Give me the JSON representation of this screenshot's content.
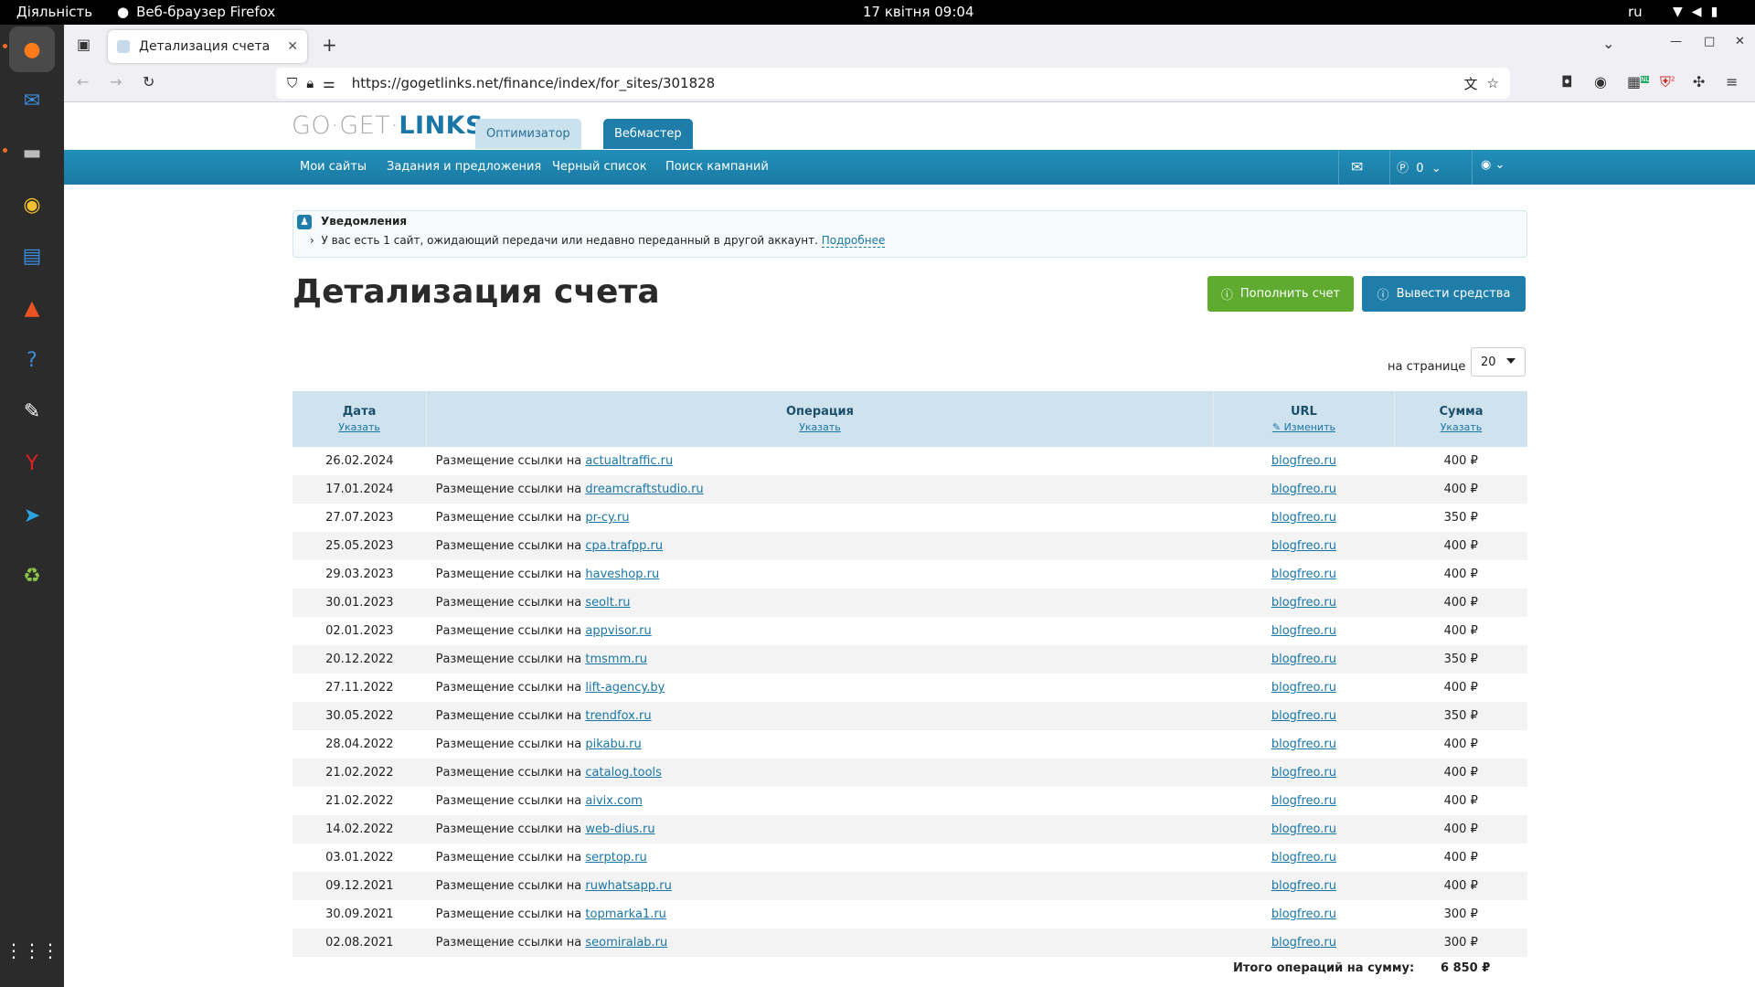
{
  "system": {
    "activities": "Діяльність",
    "app_name": "Веб-браузер Firefox",
    "datetime": "17 квітня  09:04",
    "lang": "ru"
  },
  "browser": {
    "tab_title": "Детализация счета",
    "url": "https://gogetlinks.net/finance/index/for_sites/301828",
    "ext_badge_nl": "NL",
    "ext_badge_count": "2"
  },
  "site": {
    "logo_go": "GO·GET·",
    "logo_links": "LINKS",
    "tab_optimizer": "Оптимизатор",
    "tab_webmaster": "Вебмастер",
    "nav": [
      "Мои сайты",
      "Задания и предложения",
      "Черный список",
      "Поиск кампаний"
    ],
    "balance": "0"
  },
  "notification": {
    "title": "Уведомления",
    "message": "У вас есть 1 сайт, ожидающий передачи или недавно переданный в другой аккаунт.",
    "link": "Подробнее"
  },
  "page": {
    "title": "Детализация счета",
    "topup_button": "Пополнить счет",
    "withdraw_button": "Вывести средства",
    "per_page_label": "на странице",
    "per_page_value": "20"
  },
  "table": {
    "headers": {
      "date": "Дата",
      "date_sub": "Указать",
      "operation": "Операция",
      "operation_sub": "Указать",
      "url": "URL",
      "url_sub": "Изменить",
      "sum": "Сумма",
      "sum_sub": "Указать"
    },
    "op_prefix": "Размещение ссылки на",
    "rows": [
      {
        "date": "26.02.2024",
        "site": "actualtraffic.ru",
        "url": "blogfreo.ru",
        "sum": "400 ₽"
      },
      {
        "date": "17.01.2024",
        "site": "dreamcraftstudio.ru",
        "url": "blogfreo.ru",
        "sum": "400 ₽"
      },
      {
        "date": "27.07.2023",
        "site": "pr-cy.ru",
        "url": "blogfreo.ru",
        "sum": "350 ₽"
      },
      {
        "date": "25.05.2023",
        "site": "cpa.trafpp.ru",
        "url": "blogfreo.ru",
        "sum": "400 ₽"
      },
      {
        "date": "29.03.2023",
        "site": "haveshop.ru",
        "url": "blogfreo.ru",
        "sum": "400 ₽"
      },
      {
        "date": "30.01.2023",
        "site": "seolt.ru",
        "url": "blogfreo.ru",
        "sum": "400 ₽"
      },
      {
        "date": "02.01.2023",
        "site": "appvisor.ru",
        "url": "blogfreo.ru",
        "sum": "400 ₽"
      },
      {
        "date": "20.12.2022",
        "site": "tmsmm.ru",
        "url": "blogfreo.ru",
        "sum": "350 ₽"
      },
      {
        "date": "27.11.2022",
        "site": "lift-agency.by",
        "url": "blogfreo.ru",
        "sum": "400 ₽"
      },
      {
        "date": "30.05.2022",
        "site": "trendfox.ru",
        "url": "blogfreo.ru",
        "sum": "350 ₽"
      },
      {
        "date": "28.04.2022",
        "site": "pikabu.ru",
        "url": "blogfreo.ru",
        "sum": "400 ₽"
      },
      {
        "date": "21.02.2022",
        "site": "catalog.tools",
        "url": "blogfreo.ru",
        "sum": "400 ₽"
      },
      {
        "date": "21.02.2022",
        "site": "aivix.com",
        "url": "blogfreo.ru",
        "sum": "400 ₽"
      },
      {
        "date": "14.02.2022",
        "site": "web-dius.ru",
        "url": "blogfreo.ru",
        "sum": "400 ₽"
      },
      {
        "date": "03.01.2022",
        "site": "serptop.ru",
        "url": "blogfreo.ru",
        "sum": "400 ₽"
      },
      {
        "date": "09.12.2021",
        "site": "ruwhatsapp.ru",
        "url": "blogfreo.ru",
        "sum": "400 ₽"
      },
      {
        "date": "30.09.2021",
        "site": "topmarka1.ru",
        "url": "blogfreo.ru",
        "sum": "300 ₽"
      },
      {
        "date": "02.08.2021",
        "site": "seomiralab.ru",
        "url": "blogfreo.ru",
        "sum": "300 ₽"
      }
    ],
    "total_label": "Итого операций на сумму:",
    "total_value": "6 850 ₽"
  },
  "colors": {
    "brand": "#1e7da9",
    "green": "#5fab2f",
    "header_bg": "#cfe3ee"
  }
}
